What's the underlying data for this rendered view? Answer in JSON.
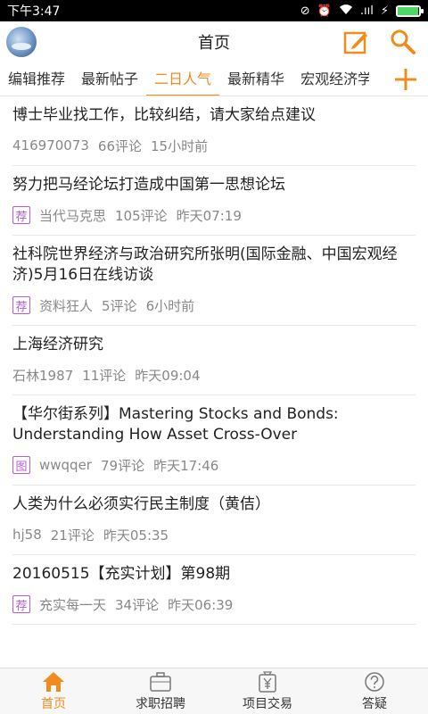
{
  "status_bar": {
    "time": "下午3:47",
    "signal": ".ııl",
    "battery_level": 0.95
  },
  "header": {
    "title": "首页"
  },
  "tabs": [
    {
      "label": "编辑推荐"
    },
    {
      "label": "最新帖子"
    },
    {
      "label": "二日人气"
    },
    {
      "label": "最新精华"
    },
    {
      "label": "宏观经济学"
    }
  ],
  "posts": [
    {
      "title": "博士毕业找工作，比较纠结，请大家给点建议",
      "badge": "",
      "author": "416970073",
      "comments": "66评论",
      "time": "15小时前"
    },
    {
      "title": "努力把马经论坛打造成中国第一思想论坛",
      "badge": "荐",
      "author": "当代马克思",
      "comments": "105评论",
      "time": "昨天07:19"
    },
    {
      "title": "社科院世界经济与政治研究所张明(国际金融、中国宏观经济)5月16日在线访谈",
      "badge": "荐",
      "author": "资料狂人",
      "comments": "5评论",
      "time": "6小时前"
    },
    {
      "title": "上海经济研究",
      "badge": "",
      "author": "石林1987",
      "comments": "11评论",
      "time": "昨天09:04"
    },
    {
      "title": "【华尔街系列】Mastering Stocks and Bonds: Understanding How Asset Cross-Over",
      "badge": "图",
      "author": "wwqqer",
      "comments": "79评论",
      "time": "昨天17:46"
    },
    {
      "title": "人类为什么必须实行民主制度（黄佶）",
      "badge": "",
      "author": "hj58",
      "comments": "21评论",
      "time": "昨天05:35"
    },
    {
      "title": "20160515【充实计划】第98期",
      "badge": "荐",
      "author": "充实每一天",
      "comments": "34评论",
      "time": "昨天06:39"
    }
  ],
  "bottom_nav": [
    {
      "label": "首页"
    },
    {
      "label": "求职招聘"
    },
    {
      "label": "项目交易"
    },
    {
      "label": "答疑"
    }
  ],
  "colors": {
    "accent": "#f08c1e",
    "badge": "#b45ed6",
    "meta": "#888888"
  }
}
